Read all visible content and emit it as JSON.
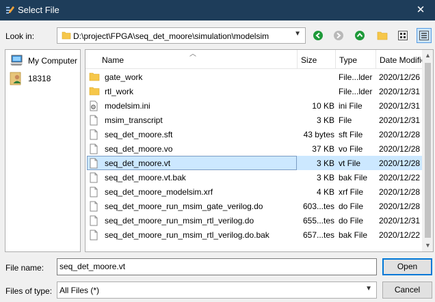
{
  "window": {
    "title": "Select File",
    "close_glyph": "✕"
  },
  "look_in": {
    "label": "Look in:",
    "path": "D:\\project\\FPGA\\seq_det_moore\\simulation\\modelsim"
  },
  "toolbar": {
    "icons": [
      "back-icon",
      "forward-icon",
      "up-icon",
      "new-folder-icon",
      "list-view-icon",
      "detail-view-icon"
    ]
  },
  "sidebar": {
    "items": [
      {
        "label": "My Computer",
        "icon": "computer-icon"
      },
      {
        "label": "18318",
        "icon": "user-folder-icon"
      }
    ]
  },
  "columns": {
    "name": "Name",
    "size": "Size",
    "type": "Type",
    "date": "Date Modified"
  },
  "files": [
    {
      "name": "gate_work",
      "size": "",
      "type": "File...lder",
      "date": "2020/12/26",
      "icon": "folder"
    },
    {
      "name": "rtl_work",
      "size": "",
      "type": "File...lder",
      "date": "2020/12/31",
      "icon": "folder"
    },
    {
      "name": "modelsim.ini",
      "size": "10 KB",
      "type": "ini File",
      "date": "2020/12/31",
      "icon": "settings"
    },
    {
      "name": "msim_transcript",
      "size": "3 KB",
      "type": "File",
      "date": "2020/12/31",
      "icon": "file"
    },
    {
      "name": "seq_det_moore.sft",
      "size": "43 bytes",
      "type": "sft File",
      "date": "2020/12/28",
      "icon": "file"
    },
    {
      "name": "seq_det_moore.vo",
      "size": "37 KB",
      "type": "vo File",
      "date": "2020/12/28",
      "icon": "file"
    },
    {
      "name": "seq_det_moore.vt",
      "size": "3 KB",
      "type": "vt File",
      "date": "2020/12/28",
      "icon": "file",
      "selected": true
    },
    {
      "name": "seq_det_moore.vt.bak",
      "size": "3 KB",
      "type": "bak File",
      "date": "2020/12/22",
      "icon": "file"
    },
    {
      "name": "seq_det_moore_modelsim.xrf",
      "size": "4 KB",
      "type": "xrf File",
      "date": "2020/12/28",
      "icon": "file"
    },
    {
      "name": "seq_det_moore_run_msim_gate_verilog.do",
      "size": "603...tes",
      "type": "do File",
      "date": "2020/12/28",
      "icon": "file"
    },
    {
      "name": "seq_det_moore_run_msim_rtl_verilog.do",
      "size": "655...tes",
      "type": "do File",
      "date": "2020/12/31",
      "icon": "file"
    },
    {
      "name": "seq_det_moore_run_msim_rtl_verilog.do.bak",
      "size": "657...tes",
      "type": "bak File",
      "date": "2020/12/22",
      "icon": "file"
    }
  ],
  "file_name": {
    "label": "File name:",
    "value": "seq_det_moore.vt"
  },
  "file_type": {
    "label": "Files of type:",
    "value": "All Files (*)"
  },
  "buttons": {
    "open": "Open",
    "cancel": "Cancel"
  },
  "colors": {
    "titlebar": "#1e3d5a",
    "selection": "#cce8ff",
    "nav_green": "#1f9a3a",
    "folder": "#f6c74a"
  }
}
